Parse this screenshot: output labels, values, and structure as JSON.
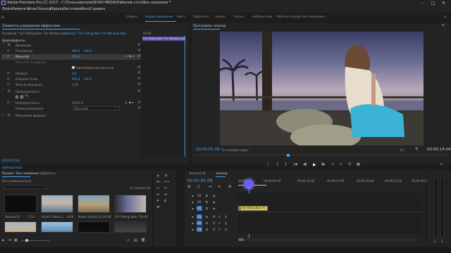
{
  "window": {
    "title": "Adobe Premiere Pro CC 2017 - C:\\Пользователи\\RUSH MEDIA\\Рабочий стол\\Без названия *",
    "minimize": "–",
    "maximize": "□",
    "close": "✕"
  },
  "menu": [
    "Файл",
    "Изменить",
    "Клип",
    "Эпизод",
    "Маркер",
    "Заголовок",
    "Окно",
    "Справка"
  ],
  "workspaces": [
    "Сборка",
    "Редактирование",
    "Цвет",
    "Эффекты",
    "Аудио",
    "Титры",
    "Библиотеки",
    "Рабочая среда без названия"
  ],
  "workspaces_active": "Редактирование",
  "effect_controls": {
    "panel_title": "Элементы управления эффектами",
    "source_tab": "Основной * Girl Sitting Near The Window.mp4",
    "sequence_tab": "эпизод * Girl Sitting Near The Window.mp4",
    "clip_label": "Girl Sitting Near The Window.mp4",
    "time_00": "00:00",
    "section_video": "Видеоэффекты",
    "effect_motion": "Движение",
    "position_label": "Положение",
    "position_x": "960,0",
    "position_y": "540,0",
    "scale_label": "Масштаб",
    "scale_value": "163,0",
    "scale_width_label": "Масштаб по ширине",
    "uniform_label": "Единообразный масштаб",
    "rotation_label": "Поворот",
    "rotation_value": "0,0",
    "anchor_label": "Опорная точка",
    "anchor_x": "960,0",
    "anchor_y": "540,0",
    "antiflicker_label": "Фильтр мерцания",
    "antiflicker_value": "0,00",
    "opacity_section": "Непрозрачность",
    "opacity_label": "Непрозрачность",
    "opacity_value": "100,0 %",
    "blend_label": "Режим наложения",
    "blend_value": "Обычный",
    "time_remap": "Изменение времени",
    "timecode": "00:00:05:09"
  },
  "program": {
    "tab": "Программа: эпизод",
    "timecode": "00:00:05:09",
    "fit_label": "По размеру кадра",
    "quality": "1/2",
    "duration": "00:00:14:04"
  },
  "transport": [
    "⌊",
    "{",
    "}",
    "|◀",
    "◀|",
    "▶",
    "|▶",
    "⊐",
    "⊏",
    "⊡",
    "▣"
  ],
  "project": {
    "tab": "Проект: Без названия",
    "tab2": "Эффекты",
    "project_file": "Без названия.prproj",
    "item_count": "11 элементов",
    "search_placeholder": "",
    "items": [
      {
        "name": "Эпизод 01",
        "dur": "5:13"
      },
      {
        "name": "Pexels Videos 1...",
        "dur": "8:08"
      },
      {
        "name": "Pexels Videos 19...",
        "dur": "10:09"
      },
      {
        "name": "Girl Sitting Near T...",
        "dur": "14:04"
      },
      {
        "name": "",
        "dur": ""
      },
      {
        "name": "",
        "dur": ""
      },
      {
        "name": "",
        "dur": ""
      },
      {
        "name": "",
        "dur": ""
      }
    ]
  },
  "timeline": {
    "tab_inactive": "Эпизод 01",
    "tab_active": "эпизод",
    "timecode": "00:00:05:09",
    "ruler": [
      "00:00",
      "00:00:05:00",
      "00:00:10:00",
      "00:00:15:00",
      "00:00:20:00",
      "00:00:25:00",
      "00:00:30:00"
    ],
    "video_tracks": [
      "V3",
      "V2",
      "V1"
    ],
    "audio_tracks": [
      "A1",
      "A2",
      "A3"
    ],
    "clip_label": "Girl Sitting Near Th"
  },
  "bottom_label": "Библиотеки",
  "colors": {
    "accent": "#3ea4f7",
    "panel": "#232323",
    "bg": "#1d1d1d",
    "playhead": "#6a5cf5"
  }
}
